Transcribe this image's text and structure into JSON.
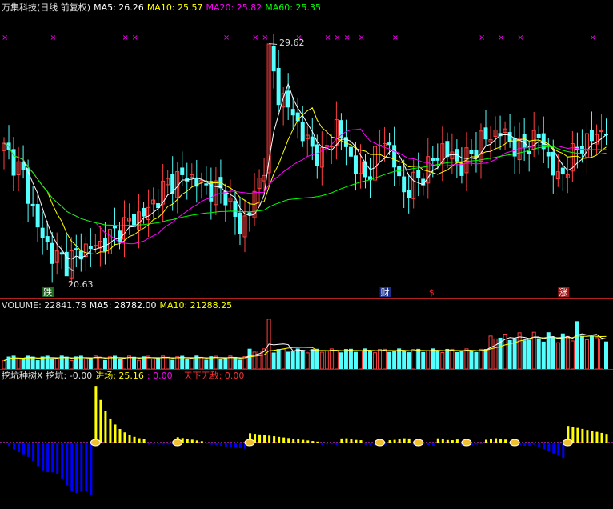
{
  "colors": {
    "background": "#000000",
    "up": "#ff4040",
    "down": "#54ffff",
    "ma5": "#ffffff",
    "ma10": "#ffff00",
    "ma20": "#ff00ff",
    "ma60": "#00ff00",
    "separator": "#b22020",
    "positive_bar": "#ffff00",
    "negative_bar": "#0000ff"
  },
  "price_panel": {
    "title": "万集科技(日线 前复权)",
    "ma5_label": "MA5: 26.26",
    "ma10_label": "MA10: 25.57",
    "ma20_label": "MA20: 25.82",
    "ma60_label": "MA60: 25.35",
    "high_marker": "29.62",
    "low_marker": "20.63",
    "markers": [
      {
        "text": "跌",
        "bar": 9,
        "bg": "#1f6b1f",
        "fg": "#ffffff"
      },
      {
        "text": "财",
        "bar": 79,
        "bg": "#1a2e8a",
        "fg": "#ffffff"
      },
      {
        "text": "$",
        "bar": 89,
        "bg": "#000000",
        "fg": "#ff2020"
      },
      {
        "text": "涨",
        "bar": 116,
        "bg": "#a01818",
        "fg": "#ffffff"
      }
    ]
  },
  "volume_panel": {
    "volume_label": "VOLUME: 22841.78",
    "ma5_label": "MA5: 28782.00",
    "ma10_label": "MA10: 21288.25"
  },
  "indicator_panel": {
    "name_label": "挖坑种树X",
    "wakeng_label": "挖坑: -0.00",
    "jinchang_label": "进场: 25.16",
    "extra_label": ": 0.00",
    "tianxia_label": "天下无敌: 0.00"
  },
  "chart_data": {
    "type": "candlestick",
    "price_range": [
      19.5,
      30.8
    ],
    "high": 29.62,
    "low": 20.63,
    "cross_marks": [
      0,
      10,
      25,
      27,
      46,
      52,
      54,
      61,
      67,
      69,
      71,
      74,
      81,
      99,
      103,
      107,
      122
    ],
    "volume_range": [
      0,
      48000
    ],
    "volume_last": 22841.78,
    "volume_ma5_last": 28782.0,
    "volume_ma10_last": 21288.25,
    "indicator_range": [
      -13,
      9
    ],
    "signal_bars": [
      19,
      36,
      51,
      78,
      86,
      96,
      106,
      117
    ]
  }
}
